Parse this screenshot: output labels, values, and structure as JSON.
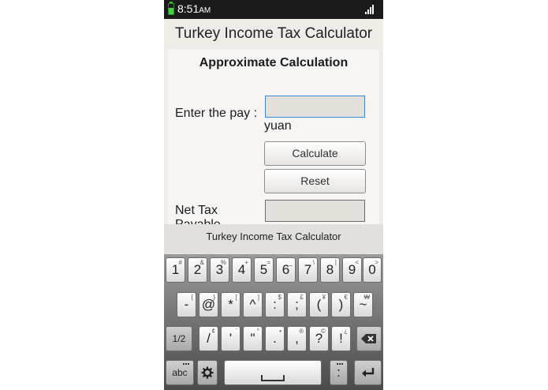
{
  "status_bar": {
    "time": "8:51",
    "ampm": "AM"
  },
  "app": {
    "title": "Turkey Income Tax Calculator"
  },
  "form": {
    "heading": "Approximate Calculation",
    "pay_label": "Enter the pay :",
    "pay_value": "",
    "unit": "yuan",
    "calculate_label": "Calculate",
    "reset_label": "Reset",
    "net_tax_label": "Net Tax",
    "net_tax_label_line2": "Payable",
    "net_tax_value": ""
  },
  "suggestion_bar": {
    "text": "Turkey Income Tax Calculator"
  },
  "keyboard": {
    "row1": [
      {
        "main": "1",
        "sec": "#"
      },
      {
        "main": "2",
        "sec": "&"
      },
      {
        "main": "3",
        "sec": "%"
      },
      {
        "main": "4",
        "sec": "+"
      },
      {
        "main": "5",
        "sec": "="
      },
      {
        "main": "6",
        "sec": "_"
      },
      {
        "main": "7",
        "sec": "\\"
      },
      {
        "main": "8",
        "sec": "|"
      },
      {
        "main": "9",
        "sec": "<"
      },
      {
        "main": "0",
        "sec": ">"
      }
    ],
    "row2": [
      {
        "main": "-",
        "sec": "{"
      },
      {
        "main": "@",
        "sec": "}"
      },
      {
        "main": "*",
        "sec": "["
      },
      {
        "main": "^",
        "sec": "]"
      },
      {
        "main": ":",
        "sec": "$"
      },
      {
        "main": ";",
        "sec": "£"
      },
      {
        "main": "(",
        "sec": "¥"
      },
      {
        "main": ")",
        "sec": "€"
      },
      {
        "main": "~",
        "sec": "₩"
      }
    ],
    "row3": [
      {
        "main": "/",
        "sec": "¢"
      },
      {
        "main": "'",
        "sec": "`"
      },
      {
        "main": "\"",
        "sec": "°"
      },
      {
        "main": ".",
        "sec": "•"
      },
      {
        "main": ",",
        "sec": "®"
      },
      {
        "main": "?",
        "sec": "©"
      },
      {
        "main": "!",
        "sec": "¿"
      }
    ],
    "shift_label": "1/2",
    "abc_label": "abc",
    "icons": {
      "backspace": "backspace-icon",
      "settings": "gear-icon",
      "space": "space-bar-icon",
      "enter": "enter-icon"
    }
  },
  "colors": {
    "status_bar": "#1b1b1b",
    "battery": "#44d144",
    "input_focus": "#3b86d9"
  }
}
